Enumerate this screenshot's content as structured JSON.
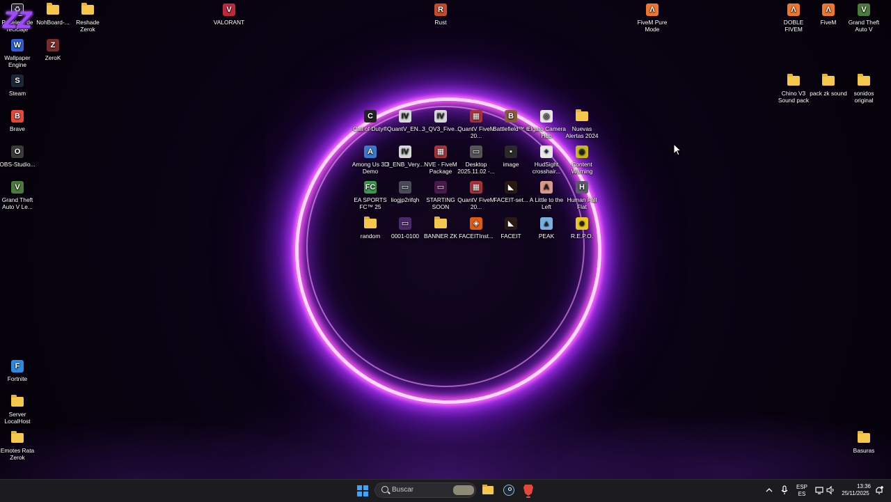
{
  "desktop": {
    "icons": [
      {
        "label": "Papelera de reciclaje",
        "kind": "recycle",
        "color": "#cfd8e6"
      },
      {
        "label": "NohBoard-...",
        "kind": "folder",
        "color": "#f5c84b"
      },
      {
        "label": "Reshade Zerok",
        "kind": "folder",
        "color": "#f5c84b"
      },
      {
        "label": "VALORANT",
        "kind": "app",
        "color": "#c0273a",
        "glyph": "V"
      },
      {
        "label": "Rust",
        "kind": "app",
        "color": "#c84a2a",
        "glyph": "R"
      },
      {
        "label": "FiveM Pure Mode",
        "kind": "app",
        "color": "#f0762c",
        "glyph": "Λ"
      },
      {
        "label": "DOBLE FIVEM",
        "kind": "app",
        "color": "#f0762c",
        "glyph": "Λ"
      },
      {
        "label": "FiveM",
        "kind": "app",
        "color": "#f0762c",
        "glyph": "Λ"
      },
      {
        "label": "Grand Theft Auto V",
        "kind": "app",
        "color": "#4c7a3a",
        "glyph": "V"
      },
      {
        "label": "Wallpaper Engine",
        "kind": "app",
        "color": "#2c5fd6",
        "glyph": "W"
      },
      {
        "label": "ZeroK",
        "kind": "app",
        "color": "#7a2c2c",
        "glyph": "Z"
      },
      {
        "label": "Steam",
        "kind": "app",
        "color": "#1b2838",
        "glyph": "S"
      },
      {
        "label": "Chino V3 Sound pack",
        "kind": "folder",
        "color": "#f5c84b"
      },
      {
        "label": "pack zk sound",
        "kind": "folder",
        "color": "#f5c84b"
      },
      {
        "label": "sonidos original",
        "kind": "folder",
        "color": "#f5c84b"
      },
      {
        "label": "Brave",
        "kind": "app",
        "color": "#e5483a",
        "glyph": "B"
      },
      {
        "label": "OBS-Studio...",
        "kind": "app",
        "color": "#3b3b3b",
        "glyph": "O"
      },
      {
        "label": "Grand Theft Auto V Le...",
        "kind": "app",
        "color": "#4c7a3a",
        "glyph": "V"
      },
      {
        "label": "Call of Duty®",
        "kind": "app",
        "color": "#222222",
        "glyph": "C"
      },
      {
        "label": "QuantV_EN...",
        "kind": "app",
        "color": "#d8d8d8",
        "glyph": "IV"
      },
      {
        "label": "3_QV3_Five...",
        "kind": "app",
        "color": "#d8d8d8",
        "glyph": "IV"
      },
      {
        "label": "QuantV FiveM 20...",
        "kind": "app",
        "color": "#a8323a",
        "glyph": "▦"
      },
      {
        "label": "Battlefield™ 6",
        "kind": "app",
        "color": "#8a5a3a",
        "glyph": "B"
      },
      {
        "label": "Elgato Camera Hub",
        "kind": "app",
        "color": "#e8e8e8",
        "glyph": "◎"
      },
      {
        "label": "Nuevas Alertas 2024",
        "kind": "folder",
        "color": "#f5c84b"
      },
      {
        "label": "Among Us 3D Demo",
        "kind": "app",
        "color": "#3a78c8",
        "glyph": "A"
      },
      {
        "label": "3_ENB_Very...",
        "kind": "app",
        "color": "#d8d8d8",
        "glyph": "IV"
      },
      {
        "label": "NVE - FiveM Package",
        "kind": "app",
        "color": "#a8323a",
        "glyph": "▦"
      },
      {
        "label": "Desktop 2025.11.02 -...",
        "kind": "app",
        "color": "#555555",
        "glyph": "▭"
      },
      {
        "label": "image",
        "kind": "app",
        "color": "#2a2a2a",
        "glyph": "▪"
      },
      {
        "label": "HudSight crosshair...",
        "kind": "app",
        "color": "#e8e8e8",
        "glyph": "+"
      },
      {
        "label": "Content Warning",
        "kind": "app",
        "color": "#c8b820",
        "glyph": "◉"
      },
      {
        "label": "EA SPORTS FC™ 25",
        "kind": "app",
        "color": "#3a9a4a",
        "glyph": "FC"
      },
      {
        "label": "liogjp2rifqh",
        "kind": "app",
        "color": "#4a4a5a",
        "glyph": "▭"
      },
      {
        "label": "STARTING SOON",
        "kind": "app",
        "color": "#4a1a4a",
        "glyph": "▭"
      },
      {
        "label": "QuantV FiveM 20...",
        "kind": "app",
        "color": "#a8323a",
        "glyph": "▦"
      },
      {
        "label": "FACEIT-set...",
        "kind": "app",
        "color": "#2a1a14",
        "glyph": "◣"
      },
      {
        "label": "A Little to the Left",
        "kind": "app",
        "color": "#d89a8a",
        "glyph": "A"
      },
      {
        "label": "Human Fall Flat",
        "kind": "app",
        "color": "#5a5a6a",
        "glyph": "H"
      },
      {
        "label": "random",
        "kind": "folder",
        "color": "#f5c84b"
      },
      {
        "label": "0001-0100",
        "kind": "app",
        "color": "#4a2a6a",
        "glyph": "▭"
      },
      {
        "label": "BANNER ZK",
        "kind": "folder",
        "color": "#f5c84b"
      },
      {
        "label": "FACEITInst...",
        "kind": "app",
        "color": "#e05a14",
        "glyph": "◈"
      },
      {
        "label": "FACEIT",
        "kind": "app",
        "color": "#2a1a14",
        "glyph": "◣"
      },
      {
        "label": "PEAK",
        "kind": "app",
        "color": "#7ab0e0",
        "glyph": "▲"
      },
      {
        "label": "R.E.P.O.",
        "kind": "app",
        "color": "#e8c820",
        "glyph": "☻"
      },
      {
        "label": "Fortnite",
        "kind": "app",
        "color": "#2c8ae0",
        "glyph": "F"
      },
      {
        "label": "Server LocalHost",
        "kind": "folder",
        "color": "#f5c84b"
      },
      {
        "label": "Emotes Rata Zerok",
        "kind": "folder",
        "color": "#f5c84b"
      },
      {
        "label": "Basuras",
        "kind": "folder",
        "color": "#f5c84b"
      }
    ]
  },
  "taskbar": {
    "search_placeholder": "Buscar",
    "apps": [
      {
        "name": "file-explorer-icon",
        "color": "#f5c84b"
      },
      {
        "name": "steam-icon",
        "color": "#1b2838"
      },
      {
        "name": "brave-icon",
        "color": "#e5483a"
      }
    ],
    "tray": {
      "language": "ESP",
      "keyboard": "ES",
      "time": "13:36",
      "date": "25/11/2025"
    }
  }
}
